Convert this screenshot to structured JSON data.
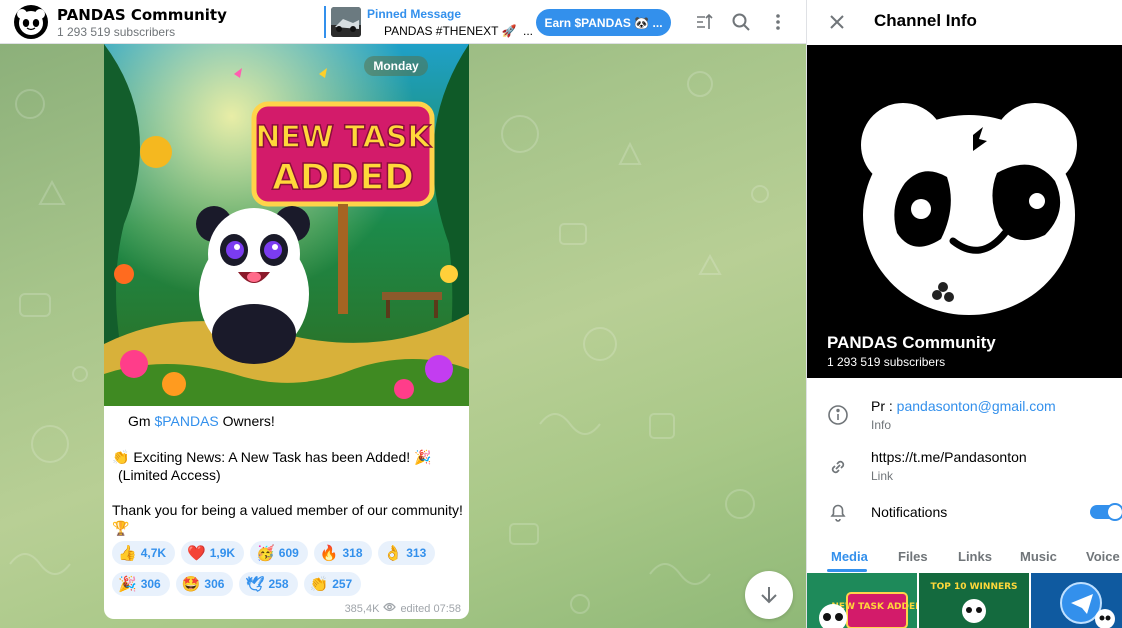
{
  "chat": {
    "title": "PANDAS Community",
    "subtitle": "1 293 519 subscribers",
    "pinned_label": "Pinned Message",
    "pinned_text": "PANDAS #THENEXT 🚀",
    "pinned_more": "...",
    "earn_button": "Earn $PANDAS 🐼 ...",
    "icons": [
      "pin-list-icon",
      "search-icon",
      "more-vertical-icon"
    ]
  },
  "message": {
    "day": "Monday",
    "image_text_1": "NEW TASK",
    "image_text_2": "ADDED",
    "line1_prefix": "Gm ",
    "line1_link": "$PANDAS",
    "line1_suffix": " Owners!",
    "line2": "👏 Exciting News: A New Task has been Added! 🎉",
    "line3": "(Limited Access)",
    "line4": "Thank you for being a valued member of our community!",
    "line5": "🏆",
    "reactions": [
      {
        "emoji": "👍",
        "count": "4,7K"
      },
      {
        "emoji": "❤️",
        "count": "1,9K"
      },
      {
        "emoji": "🥳",
        "count": "609"
      },
      {
        "emoji": "🔥",
        "count": "318"
      },
      {
        "emoji": "👌",
        "count": "313"
      },
      {
        "emoji": "🎉",
        "count": "306"
      },
      {
        "emoji": "🤩",
        "count": "306"
      },
      {
        "emoji": "🕊",
        "count": "258"
      },
      {
        "emoji": "👏",
        "count": "257"
      }
    ],
    "views": "385,4K",
    "edited": "edited 07:58"
  },
  "panel": {
    "title": "Channel Info",
    "name": "PANDAS Community",
    "subscribers": "1 293 519 subscribers",
    "info_prefix": "Pr : ",
    "info_email": "pandasonton@gmail.com",
    "info_label": "Info",
    "link_url": "https://t.me/Pandasonton",
    "link_label": "Link",
    "notifications": "Notifications",
    "tabs": [
      "Media",
      "Files",
      "Links",
      "Music",
      "Voice"
    ],
    "thumb1_text": "NEW TASK ADDED",
    "thumb2_text": "TOP 10 WINNERS"
  },
  "colors": {
    "accent": "#3390ec",
    "panel_bg": "#000000"
  }
}
